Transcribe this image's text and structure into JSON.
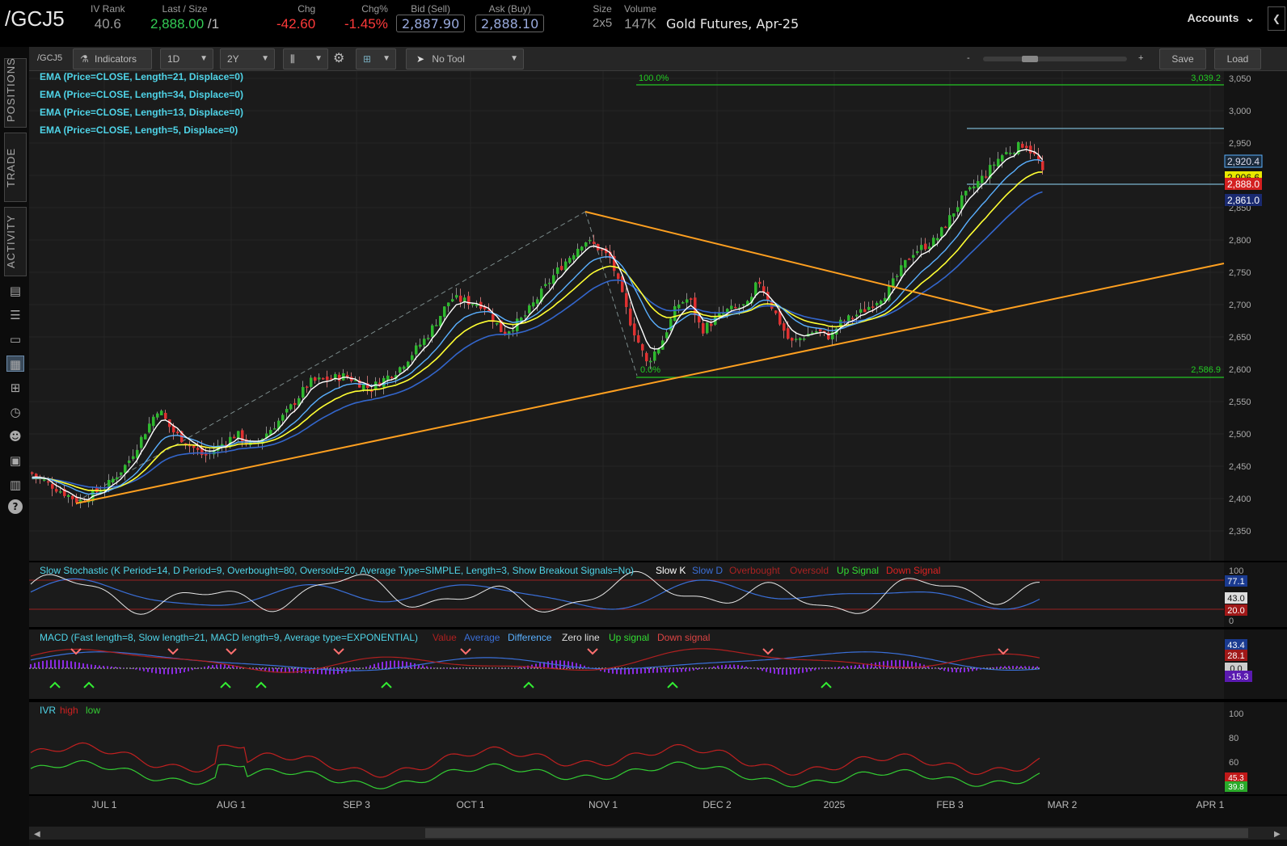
{
  "header": {
    "symbol": "/GCJ5",
    "iv_rank_label": "IV Rank",
    "iv_rank_value": "40.6",
    "last_label": "Last / Size",
    "last_value": "2,888.00",
    "last_size": "/1",
    "chg_label": "Chg",
    "chg_value": "-42.60",
    "chgpct_label": "Chg%",
    "chgpct_value": "-1.45%",
    "bid_label": "Bid (Sell)",
    "bid_value": "2,887.90",
    "ask_label": "Ask (Buy)",
    "ask_value": "2,888.10",
    "size_label": "Size",
    "size_value": "2x5",
    "volume_label": "Volume",
    "volume_value": "147K",
    "description": "Gold Futures, Apr-25",
    "accounts_label": "Accounts",
    "colors": {
      "up": "#33cc55",
      "down": "#ff3a3a",
      "label": "#9a9a9a"
    }
  },
  "rail": {
    "tabs": [
      "POSITIONS",
      "TRADE",
      "ACTIVITY"
    ],
    "icons": [
      "monitor-icon",
      "list-icon",
      "tv-icon",
      "charts-icon",
      "grid-icon",
      "gauge-icon",
      "people-icon",
      "calendar-icon",
      "news-icon",
      "help-icon"
    ]
  },
  "toolbar": {
    "symbol": "/GCJ5",
    "indicators_label": "Indicators",
    "interval": "1D",
    "period": "2Y",
    "tool": "No Tool",
    "zoom_minus": "-",
    "zoom_plus": "+",
    "save_label": "Save",
    "load_label": "Load"
  },
  "studies": {
    "ema21": "EMA (Price=CLOSE, Length=21, Displace=0)",
    "ema34": "EMA (Price=CLOSE, Length=34, Displace=0)",
    "ema13": "EMA (Price=CLOSE, Length=13, Displace=0)",
    "ema5": "EMA (Price=CLOSE, Length=5, Displace=0)",
    "colors": {
      "ema5": "#ffffff",
      "ema13": "#5ab0ff",
      "ema21": "#ffff33",
      "ema34": "#3366cc",
      "trend": "#ffa020",
      "fib": "#22aa22"
    }
  },
  "price_panel": {
    "y_ticks": [
      "3,050",
      "3,000",
      "2,950",
      "2,900",
      "2,850",
      "2,800",
      "2,750",
      "2,700",
      "2,650",
      "2,600",
      "2,550",
      "2,500",
      "2,450",
      "2,400",
      "2,350"
    ],
    "fib_top_pct": "100.0%",
    "fib_top_val": "3,039.2",
    "fib_bot_pct": "0.0%",
    "fib_bot_val": "2,586.9",
    "markers": {
      "ema5": "2,920.4",
      "ema21": "2,906.6",
      "last": "2,888.0",
      "ema34": "2,861.0"
    }
  },
  "stoch": {
    "title": "Slow Stochastic (K Period=14, D Period=9, Overbought=80, Oversold=20, Average Type=SIMPLE, Length=3, Show Breakout Signals=No)",
    "legend": [
      "Slow K",
      "Slow D",
      "Overbought",
      "Oversold",
      "Up Signal",
      "Down Signal"
    ],
    "ticks": [
      "100",
      "0"
    ],
    "markers": [
      "77.1",
      "43.0",
      "20.0"
    ]
  },
  "macd": {
    "title": "MACD (Fast length=8, Slow length=21, MACD length=9, Average type=EXPONENTIAL)",
    "legend": [
      "Value",
      "Average",
      "Difference",
      "Zero line",
      "Up signal",
      "Down signal"
    ],
    "markers": [
      "43.4",
      "28.1",
      "0.0",
      "-15.3"
    ]
  },
  "ivr": {
    "title": "IVR",
    "legend": [
      "high",
      "low"
    ],
    "ticks": [
      "100",
      "80",
      "60"
    ],
    "markers": [
      "45.3",
      "39.8"
    ]
  },
  "x_axis": [
    "JUL 1",
    "AUG 1",
    "SEP 3",
    "OCT 1",
    "NOV 1",
    "DEC 2",
    "2025",
    "FEB 3",
    "MAR 2",
    "APR 1"
  ]
}
